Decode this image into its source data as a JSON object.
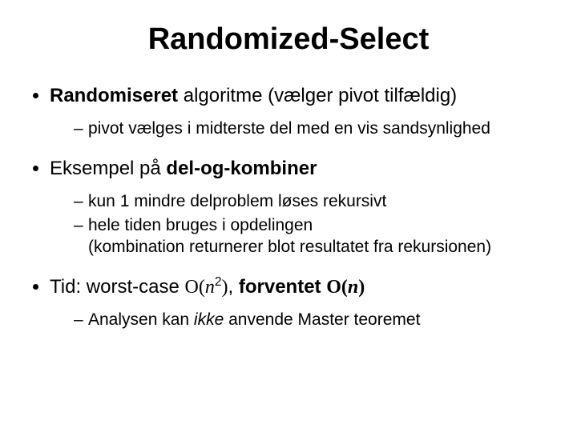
{
  "title": "Randomized-Select",
  "bullets": {
    "b1": {
      "strong": "Randomiseret",
      "rest": " algoritme (vælger pivot tilfældig)",
      "sub": {
        "s1": "pivot vælges i midterste del med en vis sandsynlighed"
      }
    },
    "b2": {
      "lead": "Eksempel på ",
      "strong": "del-og-kombiner",
      "sub": {
        "s1": "kun 1 mindre delproblem løses rekursivt",
        "s2a": "hele tiden bruges i opdelingen",
        "s2b": "(kombination returnerer blot resultatet fra rekursionen)"
      }
    },
    "b3": {
      "tid_label": "Tid: worst-case ",
      "wc_O": "O",
      "wc_open": "(",
      "wc_n": "n",
      "wc_exp": "2",
      "wc_close": ")",
      "sep": ", ",
      "exp_label": "forventet ",
      "ex_O": "O",
      "ex_open": "(",
      "ex_n": "n",
      "ex_close": ")",
      "sub": {
        "s1a": "Analysen kan ",
        "s1_em": "ikke",
        "s1b": " anvende Master teoremet"
      }
    }
  }
}
